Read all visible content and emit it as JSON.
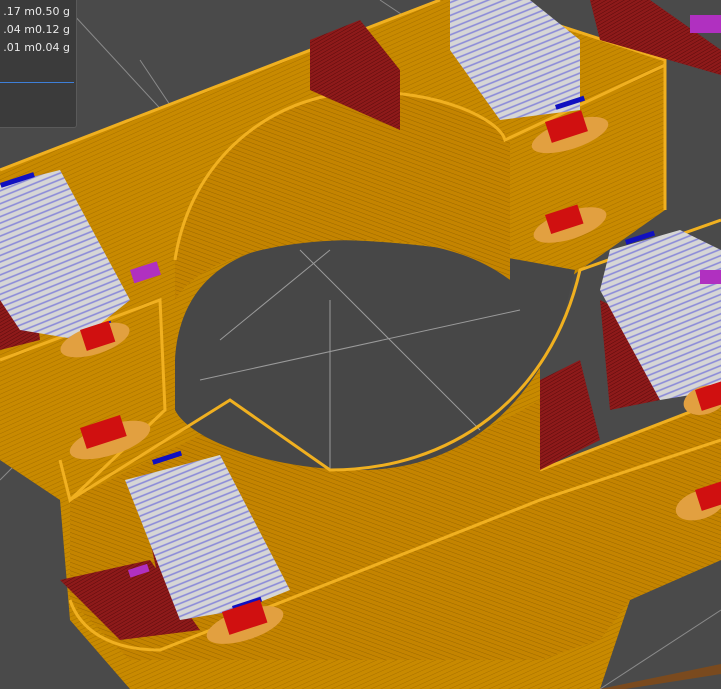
{
  "legend": {
    "rows": [
      {
        "length": ".17 m",
        "weight": "0.50 g"
      },
      {
        "length": ".04 m",
        "weight": "0.12 g"
      },
      {
        "length": ".01 m",
        "weight": "0.04 g"
      }
    ]
  },
  "colors": {
    "bed": "#4a4a4a",
    "grid": "#9a9a9a",
    "wall": "#c88a00",
    "wall_edge": "#f0b020",
    "support": "#8e1a1a",
    "infill_red": "#d01010",
    "top_blue": "#1010c0",
    "perimeter_gray": "#c8c8c8",
    "inner_lilac": "#8a8ad8",
    "purple": "#b030c0",
    "legend_line": "#3e7fd8"
  }
}
